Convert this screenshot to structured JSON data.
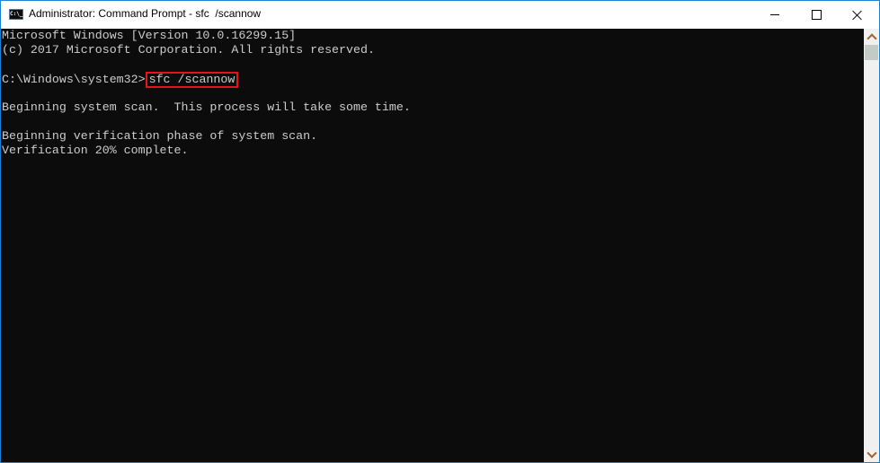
{
  "window": {
    "title": "Administrator: Command Prompt - sfc  /scannow",
    "app_icon_text": "C:\\_",
    "controls": {
      "minimize": "minimize-icon",
      "maximize": "maximize-icon",
      "close": "close-icon"
    }
  },
  "console": {
    "lines": [
      "Microsoft Windows [Version 10.0.16299.15]",
      "(c) 2017 Microsoft Corporation. All rights reserved.",
      "",
      "",
      "",
      "Beginning system scan.  This process will take some time.",
      "",
      "Beginning verification phase of system scan.",
      "Verification 20% complete."
    ],
    "prompt": "C:\\Windows\\system32>",
    "command": "sfc /scannow",
    "highlight_color": "#e81123",
    "text_color": "#cccccc",
    "background_color": "#0c0c0c"
  },
  "scrollbar": {
    "up_icon": "chevron-up-icon",
    "down_icon": "chevron-down-icon"
  }
}
